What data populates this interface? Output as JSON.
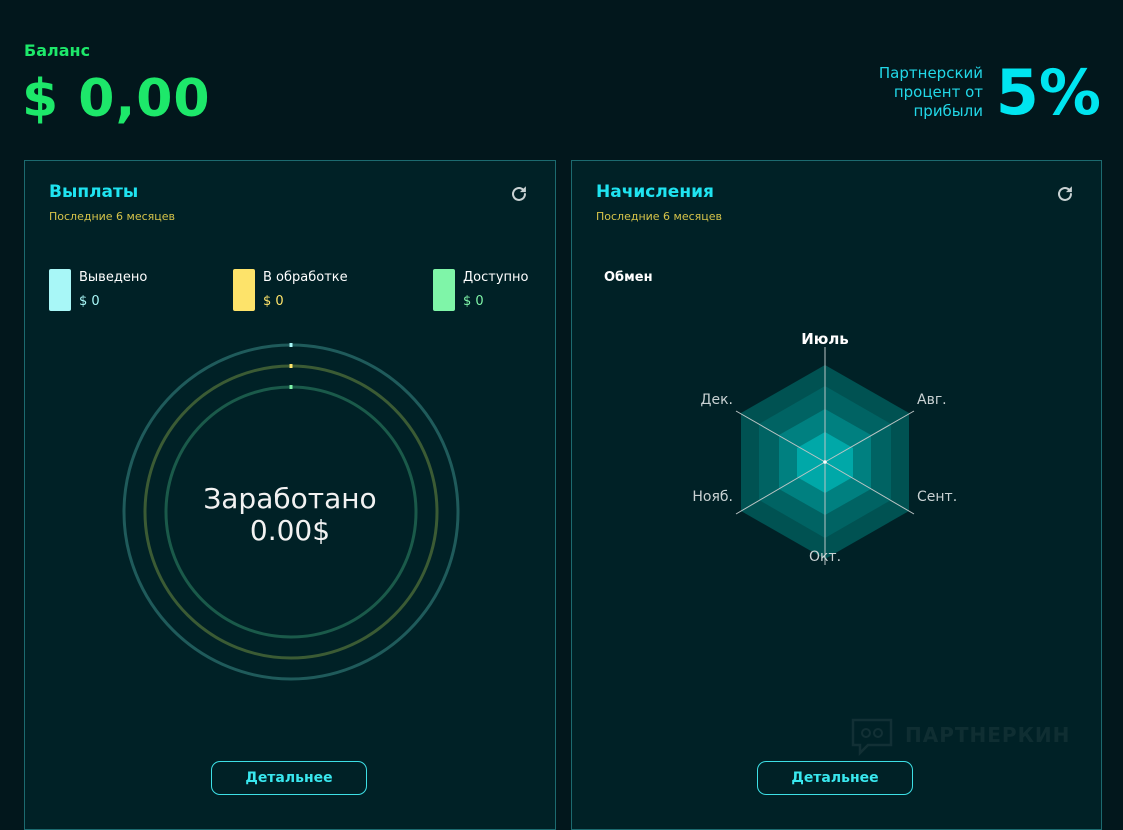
{
  "balance": {
    "label": "Баланс",
    "amount": "$ 0,00"
  },
  "partner": {
    "label": "Партнерский процент от прибыли",
    "value": "5%"
  },
  "payouts": {
    "title": "Выплаты",
    "subtitle": "Последние 6 месяцев",
    "refresh_icon": "refresh-icon",
    "legend": [
      {
        "name": "Выведено",
        "value": "$ 0",
        "color": "#a8f7f7"
      },
      {
        "name": "В обработке",
        "value": "$ 0",
        "color": "#fde36a"
      },
      {
        "name": "Доступно",
        "value": "$ 0",
        "color": "#7ff5a8"
      }
    ],
    "earned_label": "Заработано",
    "earned_value": "0.00$",
    "details_button": "Детальнее"
  },
  "accruals": {
    "title": "Начисления",
    "subtitle": "Последние 6 месяцев",
    "refresh_icon": "refresh-icon",
    "series_label": "Обмен",
    "axes": [
      "Июль",
      "Авг.",
      "Сент.",
      "Окт.",
      "Нояб.",
      "Дек."
    ],
    "details_button": "Детальнее"
  },
  "watermark": {
    "text": "ПАРТНЕРКИН"
  },
  "colors": {
    "background": "#02171c",
    "card": "#002126",
    "accent_green": "#1de86a",
    "accent_cyan": "#00e5f0",
    "subtitle_gold": "#d6c44a"
  }
}
